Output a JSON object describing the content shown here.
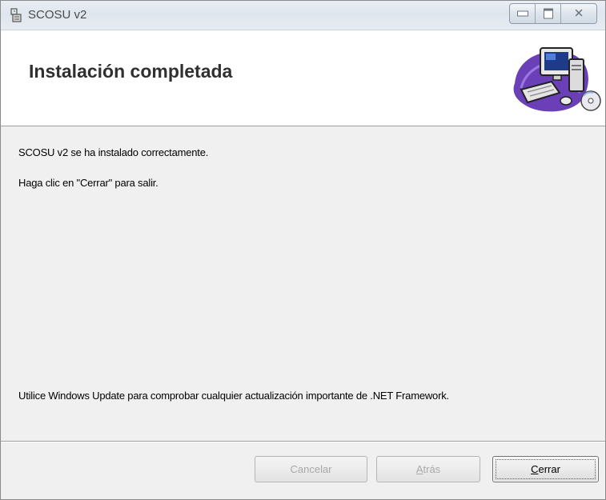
{
  "window": {
    "title": "SCOSU v2",
    "controls": {
      "minimize": "minimize",
      "maximize": "maximize",
      "close": "close"
    }
  },
  "header": {
    "title": "Instalación completada",
    "graphic": "computer-setup-icon"
  },
  "content": {
    "line1": "SCOSU v2  se ha instalado correctamente.",
    "line2": "Haga clic en \"Cerrar\" para salir.",
    "line3": "Utilice Windows Update para comprobar cualquier actualización importante de .NET Framework."
  },
  "buttons": {
    "cancel": {
      "mnemonic": "",
      "rest": "Cancelar",
      "enabled": false
    },
    "back": {
      "mnemonic": "A",
      "rest": "trás",
      "enabled": false
    },
    "close": {
      "mnemonic": "C",
      "rest": "errar",
      "enabled": true
    }
  },
  "colors": {
    "background": "#f0f0f0",
    "header_bg": "#ffffff",
    "disabled_text": "#a8a8a8"
  }
}
